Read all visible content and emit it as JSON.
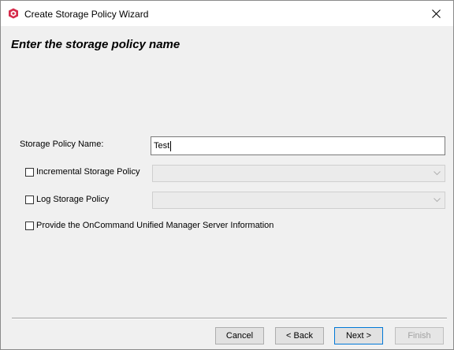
{
  "window": {
    "title": "Create Storage Policy Wizard",
    "heading": "Enter the storage policy name"
  },
  "form": {
    "name_label": "Storage Policy Name:",
    "name_value": "Test",
    "incremental_label": "Incremental Storage Policy",
    "incremental_checked": false,
    "log_label": "Log Storage Policy",
    "log_checked": false,
    "oncommand_label": "Provide the OnCommand Unified Manager Server Information",
    "oncommand_checked": false
  },
  "buttons": {
    "cancel": "Cancel",
    "back": "< Back",
    "next": "Next >",
    "finish": "Finish"
  },
  "colors": {
    "brand_icon": "#d62b4b",
    "default_button_border": "#0078d7"
  }
}
